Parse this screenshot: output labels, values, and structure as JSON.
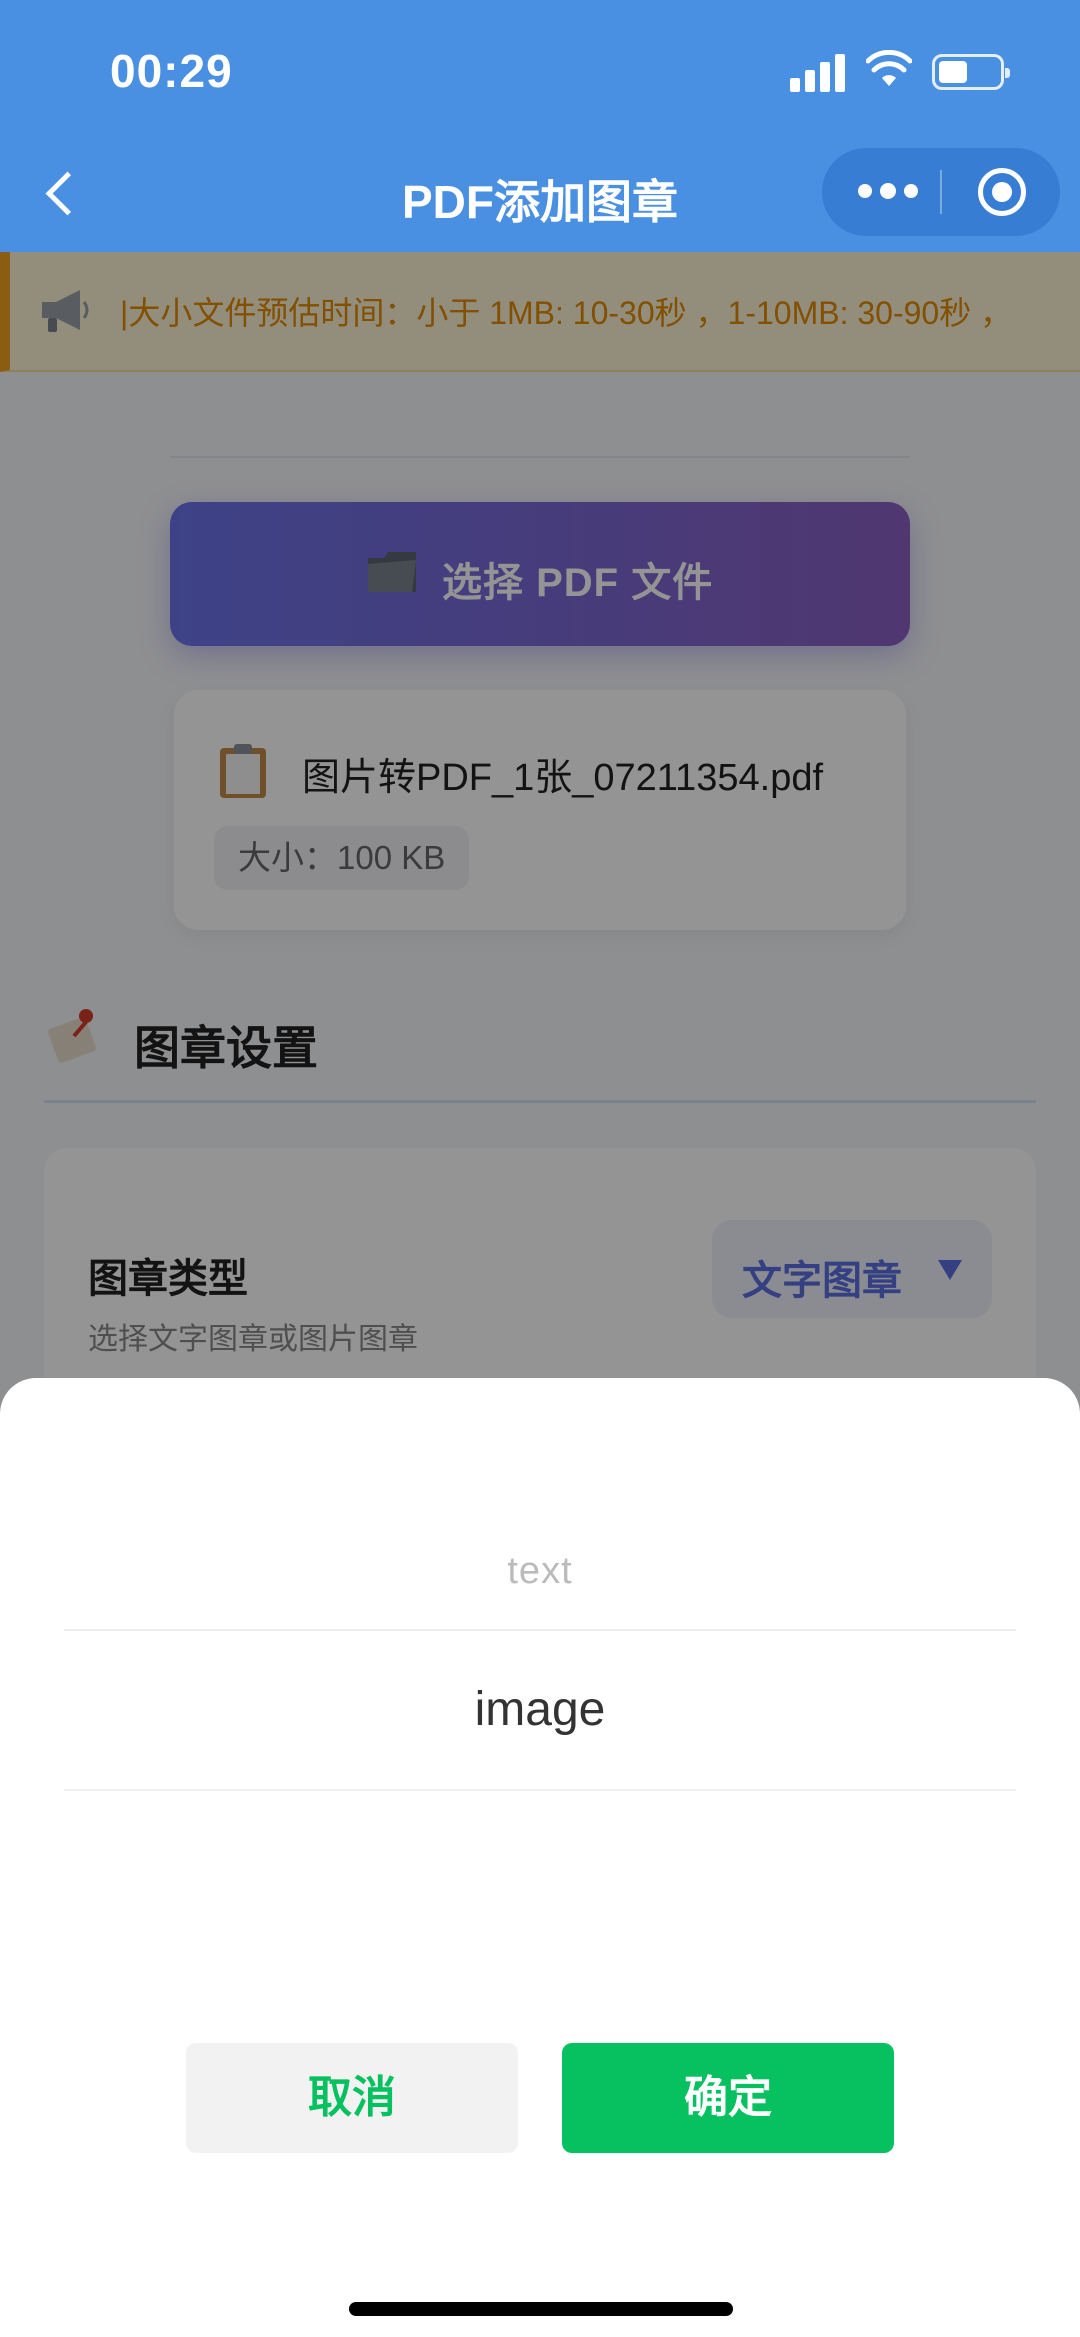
{
  "status_bar": {
    "time": "00:29"
  },
  "nav": {
    "title": "PDF添加图章"
  },
  "notice": {
    "text": "|大小文件预估时间：小于 1MB: 10-30秒 ，1-10MB: 30-90秒 ，"
  },
  "upload": {
    "button_label": "选择 PDF 文件"
  },
  "file": {
    "name": "图片转PDF_1张_07211354.pdf",
    "size_label": "大小：100 KB"
  },
  "stamp_section": {
    "title": "图章设置",
    "type_label": "图章类型",
    "type_desc": "选择文字图章或图片图章",
    "type_value": "文字图章"
  },
  "picker": {
    "options": [
      "text",
      "image"
    ],
    "cancel_label": "取消",
    "confirm_label": "确定"
  },
  "colors": {
    "header": "#4a90e2",
    "accent": "#07c160",
    "notice": "#e08a00"
  },
  "icons": [
    "back-icon",
    "more-icon",
    "capsule-close-icon",
    "megaphone-icon",
    "folder-icon",
    "clipboard-icon",
    "stamp-icon",
    "dropdown-arrow-icon"
  ]
}
